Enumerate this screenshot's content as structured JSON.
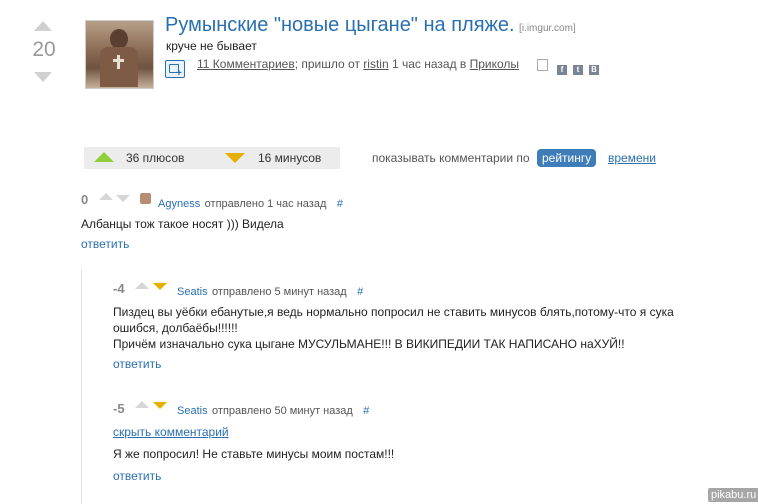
{
  "post": {
    "score": "20",
    "title": "Румынские \"новые цыгане\" на пляже.",
    "domain": "[i.imgur.com]",
    "subtitle": "круче не бывает",
    "comments_link": "11 Комментариев",
    "posted_by_prefix": "; пришло от ",
    "author": "ristin",
    "time_text": " 1 час назад в ",
    "category": "Приколы",
    "share_icons": [
      "facebook-icon",
      "twitter-icon",
      "vkontakte-icon"
    ]
  },
  "votes_bar": {
    "plus_label": "36 плюсов",
    "minus_label": "16 минусов",
    "sort_prefix": "показывать комментарии по",
    "sort_active": "рейтингу",
    "sort_other": "времени"
  },
  "comments": [
    {
      "score": "0",
      "author": "Agyness",
      "meta": "отправлено 1 час назад",
      "hash": "#",
      "lines": [
        "Албанцы тож такое носят ))) Видела"
      ],
      "reply": "ответить"
    },
    {
      "score": "-4",
      "author": "Seatis",
      "meta": "отправлено 5 минут назад",
      "hash": "#",
      "lines": [
        "Пиздец вы уёбки ебанутые,я ведь нормально попросил не ставить минусов блять,потому-что я сука",
        "ошибся, долбаёбы!!!!!!",
        "Причём изначально сука цыгане МУСУЛЬМАНЕ!!! В ВИКИПЕДИИ ТАК НАПИСАНО наХУЙ!!"
      ],
      "reply": "ответить"
    },
    {
      "score": "-5",
      "author": "Seatis",
      "meta": "отправлено 50 минут назад",
      "hash": "#",
      "hide": "скрыть комментарий",
      "lines": [
        "Я же попросил! Не ставьте минусы моим постам!!!"
      ],
      "reply": "ответить"
    }
  ],
  "watermark": "pikabu.ru",
  "colors": {
    "link": "#2a6fb0",
    "sort_active_bg": "#3f7db8",
    "vote_up": "#8ecf3a",
    "vote_down": "#e5b000"
  }
}
